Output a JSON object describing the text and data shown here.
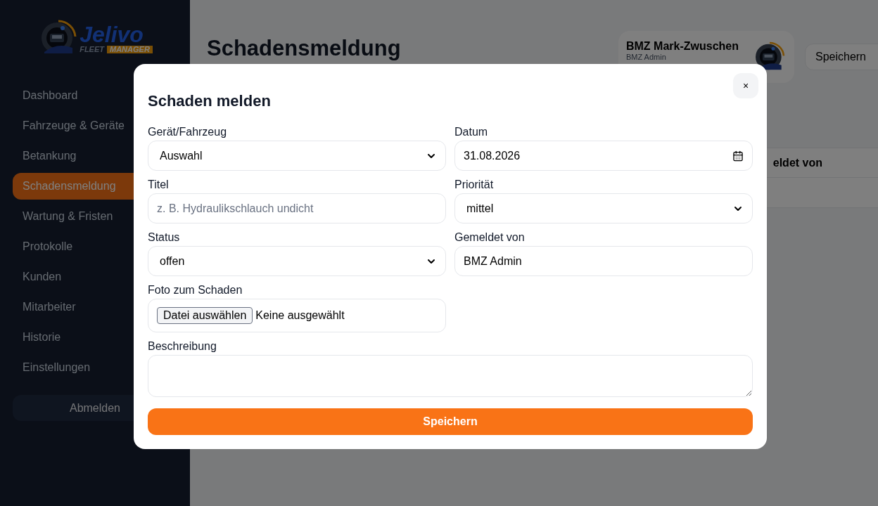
{
  "sidebar": {
    "logo": {
      "name": "Jelivo",
      "tagline_1": "FLEET",
      "tagline_2": "MANAGER"
    },
    "items": [
      {
        "label": "Dashboard",
        "selected": false
      },
      {
        "label": "Fahrzeuge & Geräte",
        "selected": false
      },
      {
        "label": "Betankung",
        "selected": false
      },
      {
        "label": "Schadensmeldung",
        "selected": true
      },
      {
        "label": "Wartung & Fristen",
        "selected": false
      },
      {
        "label": "Protokolle",
        "selected": false
      },
      {
        "label": "Kunden",
        "selected": false
      },
      {
        "label": "Mitarbeiter",
        "selected": false
      },
      {
        "label": "Historie",
        "selected": false
      },
      {
        "label": "Einstellungen",
        "selected": false
      }
    ],
    "logout": "Abmelden"
  },
  "page": {
    "title": "Schadensmeldung",
    "user": {
      "name": "BMZ Mark-Zwuschen",
      "role": "BMZ Admin"
    },
    "save_button": "Speichern",
    "table": {
      "columns": [
        "eldet von"
      ]
    }
  },
  "modal": {
    "title": "Schaden melden",
    "close": "×",
    "fields": [
      {
        "label": "Gerät/Fahrzeug",
        "kind": "select",
        "value": "Auswahl"
      },
      {
        "label": "Datum",
        "kind": "date",
        "value": "31.08.2026"
      },
      {
        "label": "Titel",
        "kind": "text",
        "placeholder": "z. B. Hydraulikschlauch undicht"
      },
      {
        "label": "Priorität",
        "kind": "select",
        "value": "mittel"
      },
      {
        "label": "Status",
        "kind": "select",
        "value": "offen"
      },
      {
        "label": "Gemeldet von",
        "kind": "text",
        "value": "BMZ Admin"
      },
      {
        "label": "Foto zum Schaden",
        "kind": "file",
        "button": "Datei auswählen",
        "value": "Keine ausgewählt"
      },
      {
        "label": "Beschreibung",
        "kind": "textarea"
      }
    ],
    "submit": "Speichern"
  }
}
